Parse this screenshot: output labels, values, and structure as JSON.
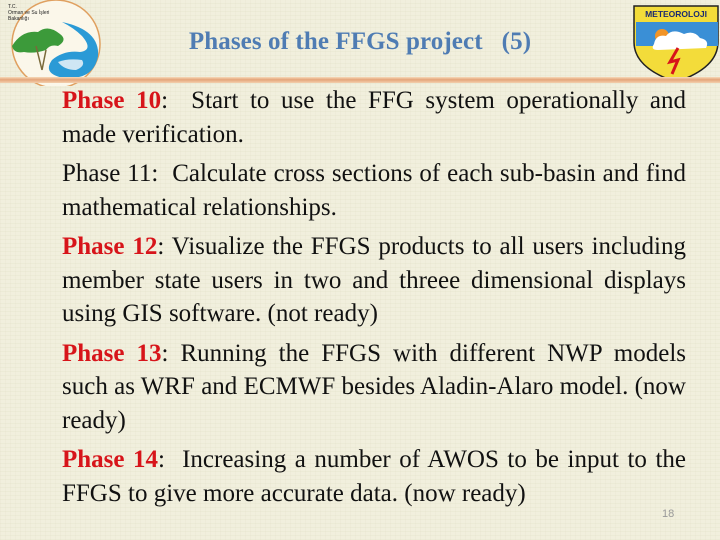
{
  "slide": {
    "title": "Phases of the FFGS project   (5)",
    "page_number": "18",
    "left_logo": {
      "icon": "ministry-forestry-water-logo",
      "text_lines": [
        "T.C.",
        "Orman ve Su İşleri",
        "Bakanlığı"
      ]
    },
    "right_logo": {
      "icon": "meteoroloji-shield-logo",
      "text": "METEOROLOJI"
    },
    "colors": {
      "title": "#4f7cb3",
      "phase_label": "#d7141a",
      "rule": "#e5a57a",
      "background": "#f1efdd"
    },
    "phases": [
      {
        "label": "Phase 10",
        "highlighted": true,
        "separator": ":",
        "text": "  Start to use the FFG system operationally and made verification."
      },
      {
        "label": "Phase 11",
        "highlighted": false,
        "separator": ":",
        "text": "  Calculate cross sections of each sub-basin and find mathematical relationships."
      },
      {
        "label": "Phase 12",
        "highlighted": true,
        "separator": ":",
        "text": " Visualize the FFGS products to all users including member state users in two and threee dimensional displays using GIS software. (not ready)"
      },
      {
        "label": "Phase 13",
        "highlighted": true,
        "separator": ":",
        "text": " Running the FFGS with different NWP models such as WRF and ECMWF besides Aladin-Alaro model. (now ready)"
      },
      {
        "label": "Phase 14",
        "highlighted": true,
        "separator": ":",
        "text": "  Increasing a number of AWOS to be input to the FFGS to give more accurate data. (now ready)"
      }
    ]
  }
}
